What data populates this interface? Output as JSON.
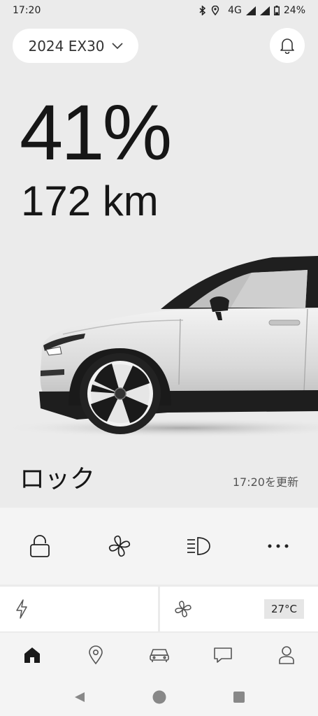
{
  "status_bar": {
    "time": "17:20",
    "network": "4G",
    "battery": "24%",
    "icons": [
      "bluetooth-icon",
      "location-icon",
      "signal-icon",
      "signal-icon",
      "battery-icon"
    ]
  },
  "header": {
    "model": "2024 EX30",
    "model_icon": "chevron-down-icon",
    "bell_icon": "bell-icon"
  },
  "vehicle": {
    "battery_percent": "41%",
    "range": "172 km",
    "lock_status": "ロック",
    "updated": "17:20を更新"
  },
  "quick_actions": [
    {
      "icon": "lock-icon"
    },
    {
      "icon": "fan-icon"
    },
    {
      "icon": "headlight-icon"
    },
    {
      "icon": "more-icon"
    }
  ],
  "cards": {
    "charge_icon": "lightning-icon",
    "climate_icon": "fan-icon",
    "temperature": "27°C"
  },
  "bottom_nav": [
    {
      "icon": "home-icon",
      "active": true
    },
    {
      "icon": "map-pin-icon"
    },
    {
      "icon": "car-icon"
    },
    {
      "icon": "chat-icon"
    },
    {
      "icon": "user-icon"
    }
  ],
  "system_nav": [
    "back-icon",
    "home-circle-icon",
    "recents-icon"
  ],
  "colors": {
    "background": "#ebebeb",
    "panel": "#f4f4f4",
    "text": "#161616",
    "secondary_text": "#555555"
  }
}
